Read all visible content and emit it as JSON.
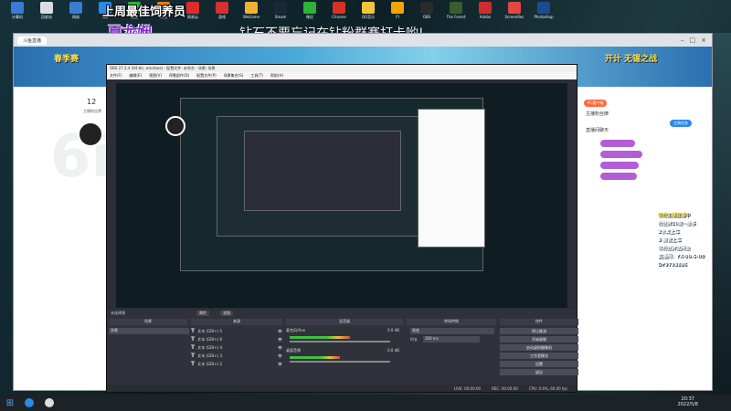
{
  "desktop": {
    "icons": [
      {
        "label": "计算机",
        "color": "#3a7bd5"
      },
      {
        "label": "回收站",
        "color": "#d9dde2"
      },
      {
        "label": "网络",
        "color": "#3a7bd5"
      },
      {
        "label": "QQ",
        "color": "#2a8ae6"
      },
      {
        "label": "微信",
        "color": "#2fb23a"
      },
      {
        "label": "斗鱼",
        "color": "#ff7a1a"
      },
      {
        "label": "网易云",
        "color": "#e02b2b"
      },
      {
        "label": "游戏",
        "color": "#d63030"
      },
      {
        "label": "WeGame",
        "color": "#f2b134"
      },
      {
        "label": "Steam",
        "color": "#1b2838"
      },
      {
        "label": "微信",
        "color": "#2fb23a"
      },
      {
        "label": "Chrome",
        "color": "#d93025"
      },
      {
        "label": "QQ音乐",
        "color": "#f5c43a"
      },
      {
        "label": "YY",
        "color": "#f2a400"
      },
      {
        "label": "OBS",
        "color": "#2a2a2a"
      },
      {
        "label": "The Forest",
        "color": "#3b5d2c"
      },
      {
        "label": "Adobe",
        "color": "#d12c2c"
      },
      {
        "label": "ScreenRec",
        "color": "#e64545"
      },
      {
        "label": "Photoshop",
        "color": "#1d4a8f"
      }
    ]
  },
  "overlay": {
    "title": "上周最佳饲养员",
    "name": "夏龙娴",
    "scroll_text": "钻石不要忘记在钻粉群赛打卡哟!"
  },
  "browser": {
    "tab_label": "斗鱼直播",
    "banner_left": "春季赛",
    "banner_right": "开计 无锡之战",
    "left": {
      "count": "12",
      "count_label": "主播粉丝牌"
    },
    "right": {
      "pc_label": "PC客户端",
      "rank_label": "主播粉丝牌",
      "week_label": "主周任务",
      "chat_label": "直播间聊天"
    }
  },
  "side_panel": {
    "lines": [
      "吸粉主播直播中",
      "粉丝牌10级~能够",
      "2水友上车",
      "3 房管上车",
      "吸粉丝牌送网鱼",
      "直播间：YX-00-5-00",
      "DY9793886"
    ]
  },
  "obs": {
    "window_title": "OBS 27.2.4 (64-bit, windows) - 配置文件: 未命名 - 场景: 场景",
    "menu": [
      "文件(F)",
      "编辑(E)",
      "视图(V)",
      "停靠部件(D)",
      "配置文件(P)",
      "场景集合(S)",
      "工具(T)",
      "帮助(H)"
    ],
    "no_source_label": "未选择源",
    "props_btn": "属性",
    "filter_btn": "滤镜",
    "docks": {
      "scenes": "场景",
      "sources": "来源",
      "mixer": "混音器",
      "transitions": "转场特效",
      "controls": "控件"
    },
    "scene_item": "场景",
    "sources_list": [
      "文本 (GDI+) 5",
      "文本 (GDI+) 6",
      "文本 (GDI+) 4",
      "文本 (GDI+) 3",
      "文本 (GDI+) 2"
    ],
    "mixer": [
      {
        "name": "麦克风/Aux",
        "db": "0.0 dB",
        "level": 0.6
      },
      {
        "name": "桌面音频",
        "db": "0.0 dB",
        "level": 0.5
      }
    ],
    "transition": {
      "type": "渐变",
      "duration_label": "时长",
      "duration": "300 ms"
    },
    "controls": [
      "停止推流",
      "开始录制",
      "启动虚拟摄像机",
      "工作室模式",
      "设置",
      "退出"
    ],
    "status": {
      "live": "LIVE: 00:00:00",
      "rec": "REC: 00:00:00",
      "cpu": "CPU: 0.6%, 60.00 fps"
    }
  },
  "taskbar": {
    "time": "20:37",
    "date": "2022/5/8"
  }
}
